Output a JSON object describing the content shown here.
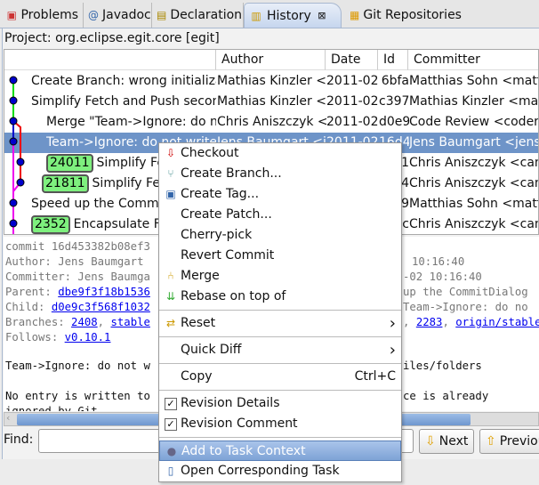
{
  "tabs": [
    {
      "label": "Problems",
      "icon": "problems-icon"
    },
    {
      "label": "Javadoc",
      "icon": "at-icon"
    },
    {
      "label": "Declaration",
      "icon": "declaration-icon"
    },
    {
      "label": "History",
      "icon": "history-icon",
      "active": true
    },
    {
      "label": "Git Repositories",
      "icon": "git-repositories-icon"
    }
  ],
  "project": "Project: org.eclipse.egit.core [egit]",
  "columns": [
    "Author",
    "Date",
    "Id",
    "Committer"
  ],
  "rows": [
    {
      "message": "Create Branch: wrong initialization",
      "author": "Mathias Kinzler <",
      "date": "2011-02",
      "id": "6bfa",
      "committer": "Matthias Sohn <matthias"
    },
    {
      "message": "Simplify Fetch and Push second",
      "author": "Mathias Kinzler <",
      "date": "2011-02",
      "id": "c397",
      "committer": "Mathias Kinzler <mathias"
    },
    {
      "message": "Merge \"Team->Ignore: do not",
      "author": "Chris Aniszczyk <",
      "date": "2011-02",
      "id": "d0e9",
      "committer": "Code Review <codereview"
    },
    {
      "message": "Team->Ignore: do not write e",
      "author": "Jens Baumgart <je",
      "date": "2011-02",
      "id": "16d4",
      "committer": "Jens Baumgart <jens.baumgart"
    },
    {
      "badge": "24011",
      "message": "Simplify Fe",
      "id": "1",
      "committer": "Chris Aniszczyk <caniszczyk"
    },
    {
      "badge": "21811",
      "message": "Simplify Fe",
      "id": "4",
      "committer": "Chris Aniszczyk <caniszczyk"
    },
    {
      "message": "Speed up the Commit",
      "id": "9",
      "committer": "Matthias Sohn <matthias"
    },
    {
      "badge": "2352",
      "message": "Encapsulate Fe",
      "id": "c",
      "committer": "Chris Aniszczyk <caniszczyk"
    }
  ],
  "details": {
    "commit": "commit 16d453382b08ef3",
    "author": "Author: Jens Baumgart",
    "author_time": "10:16:40",
    "committer": "Committer: Jens Baumga",
    "committer_time": "-02 10:16:40",
    "parent_label": "Parent: ",
    "parent_link": "dbe9f3f18b1536",
    "parent_right": "up the CommitDialog",
    "child_label": "Child: ",
    "child_link": "d0e9c3f568f1032",
    "child_right": "Team->Ignore: do no",
    "branches_label": "Branches: ",
    "branch1": "2408",
    "branch2": "stable",
    "branch3": "2283",
    "branch4": "origin/stable",
    "follows_label": "Follows: ",
    "follows_link": "v0.10.1",
    "msg1": "Team->Ignore: do not w",
    "msg1_right": "iles/folders",
    "msg2": "No entry is written to",
    "msg2_right": "ce is already",
    "msg3": "ignored by Git"
  },
  "find": {
    "label": "Find:",
    "value": "",
    "next": "Next",
    "previous": "Previous"
  },
  "menu": [
    {
      "label": "Checkout",
      "icon": "checkout-icon"
    },
    {
      "label": "Create Branch...",
      "icon": "branch-icon"
    },
    {
      "label": "Create Tag...",
      "icon": "tag-icon"
    },
    {
      "label": "Create Patch..."
    },
    {
      "label": "Cherry-pick"
    },
    {
      "label": "Revert Commit"
    },
    {
      "label": "Merge",
      "icon": "merge-icon"
    },
    {
      "label": "Rebase on top of",
      "icon": "rebase-icon"
    },
    {
      "label": "Reset",
      "icon": "reset-icon",
      "submenu": true
    },
    {
      "label": "Quick Diff",
      "submenu": true
    },
    {
      "label": "Copy",
      "shortcut": "Ctrl+C"
    },
    {
      "label": "Revision Details",
      "checked": true
    },
    {
      "label": "Revision Comment",
      "checked": true
    },
    {
      "label": "Add to Task Context",
      "icon": "task-context-icon",
      "highlighted": true
    },
    {
      "label": "Open Corresponding Task",
      "icon": "task-icon"
    }
  ],
  "colors": {
    "selection": "#6e94c8",
    "badge": "#7ef07e",
    "link": "#0000ee",
    "menu_highlight": "#7ea3d6"
  }
}
